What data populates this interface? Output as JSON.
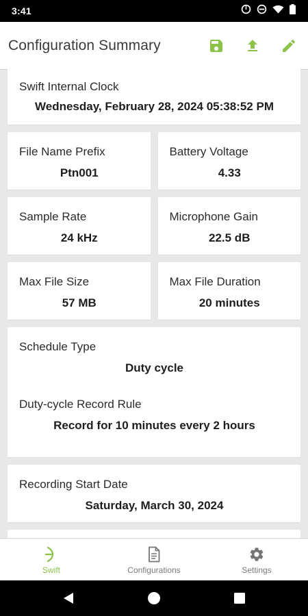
{
  "status_bar": {
    "time": "3:41"
  },
  "app_bar": {
    "title": "Configuration Summary"
  },
  "colors": {
    "accent": "#8bc34a",
    "icon_gray": "#757575"
  },
  "cards": {
    "clock": {
      "label": "Swift Internal Clock",
      "value": "Wednesday, February 28, 2024 05:38:52 PM"
    },
    "file_prefix": {
      "label": "File Name Prefix",
      "value": "Ptn001"
    },
    "battery": {
      "label": "Battery Voltage",
      "value": "4.33"
    },
    "sample_rate": {
      "label": "Sample Rate",
      "value": "24 kHz"
    },
    "mic_gain": {
      "label": "Microphone Gain",
      "value": "22.5 dB"
    },
    "max_size": {
      "label": "Max File Size",
      "value": "57 MB"
    },
    "max_duration": {
      "label": "Max File Duration",
      "value": "20 minutes"
    },
    "schedule": {
      "label": "Schedule Type",
      "value": "Duty cycle",
      "rule_label": "Duty-cycle Record Rule",
      "rule_value": "Record for 10 minutes every 2 hours"
    },
    "start_date": {
      "label": "Recording Start Date",
      "value": "Saturday, March 30, 2024"
    }
  },
  "bottom_nav": [
    {
      "label": "Swift",
      "icon": "swift-icon",
      "active": true
    },
    {
      "label": "Configurations",
      "icon": "document-icon",
      "active": false
    },
    {
      "label": "Settings",
      "icon": "gear-icon",
      "active": false
    }
  ]
}
